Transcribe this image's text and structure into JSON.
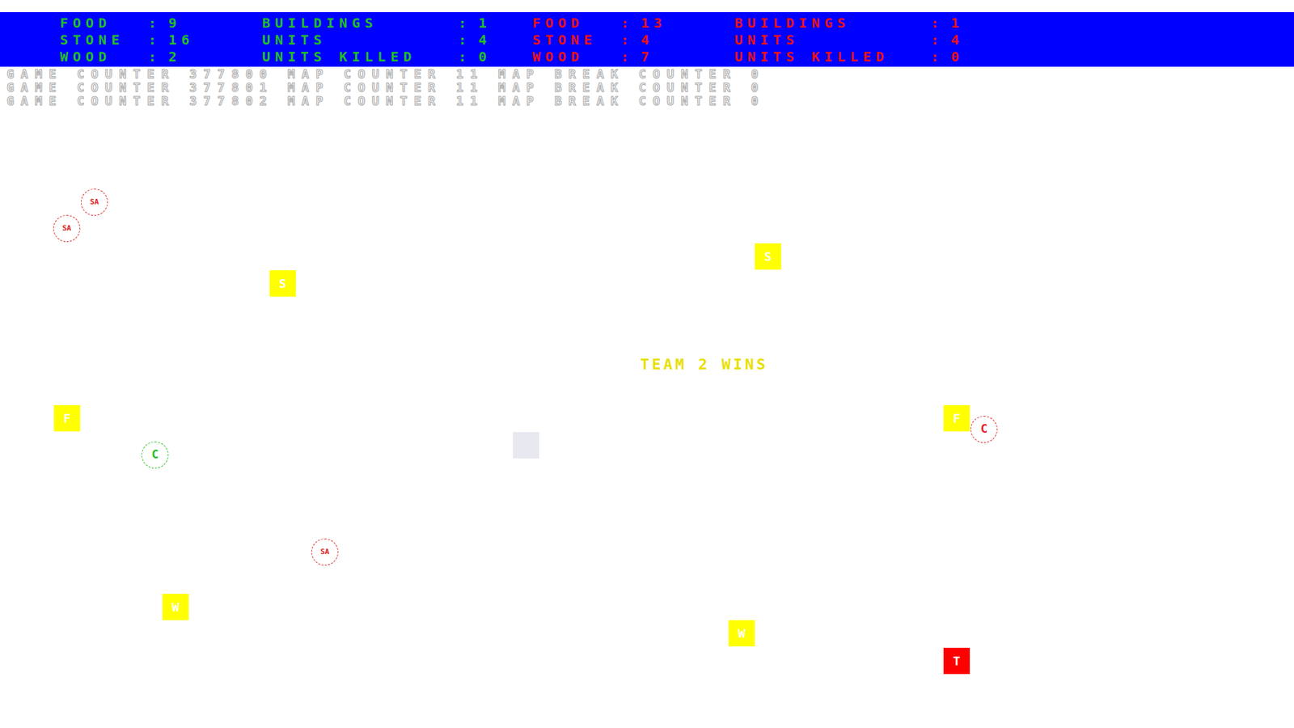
{
  "teams": [
    {
      "name": "team-1",
      "color": "#22c022",
      "resources": [
        {
          "label": "FOOD",
          "value": "9"
        },
        {
          "label": "STONE",
          "value": "16"
        },
        {
          "label": "WOOD",
          "value": "2"
        }
      ],
      "totals": [
        {
          "label": "BUILDINGS",
          "value": "1"
        },
        {
          "label": "UNITS",
          "value": "4"
        },
        {
          "label": "UNITS KILLED",
          "value": "0"
        }
      ]
    },
    {
      "name": "team-2",
      "color": "#ee1111",
      "resources": [
        {
          "label": "FOOD",
          "value": "13"
        },
        {
          "label": "STONE",
          "value": "4"
        },
        {
          "label": "WOOD",
          "value": "7"
        }
      ],
      "totals": [
        {
          "label": "BUILDINGS",
          "value": "1"
        },
        {
          "label": "UNITS",
          "value": "4"
        },
        {
          "label": "UNITS KILLED",
          "value": "0"
        }
      ]
    }
  ],
  "separator": ":",
  "counters": [
    "GAME COUNTER 377800 MAP COUNTER 11 MAP BREAK COUNTER 0",
    "GAME COUNTER 377801 MAP COUNTER 11 MAP BREAK COUNTER 0",
    "GAME COUNTER 377802 MAP COUNTER 11 MAP BREAK COUNTER 0"
  ],
  "message": "TEAM 2 WINS",
  "entities": [
    {
      "kind": "unit",
      "label": "SA",
      "color": "#dd2222"
    },
    {
      "kind": "unit",
      "label": "SA",
      "color": "#dd2222"
    },
    {
      "kind": "unit",
      "label": "SA",
      "color": "#dd2222"
    },
    {
      "kind": "unit",
      "label": "C",
      "color": "#22c022"
    },
    {
      "kind": "unit",
      "label": "C",
      "color": "#dd2222"
    },
    {
      "kind": "resource",
      "label": "S",
      "color": "#ffff00"
    },
    {
      "kind": "resource",
      "label": "S",
      "color": "#ffff00"
    },
    {
      "kind": "resource",
      "label": "F",
      "color": "#ffff00"
    },
    {
      "kind": "resource",
      "label": "F",
      "color": "#ffff00"
    },
    {
      "kind": "resource",
      "label": "W",
      "color": "#ffff00"
    },
    {
      "kind": "resource",
      "label": "W",
      "color": "#ffff00"
    },
    {
      "kind": "building",
      "label": "T",
      "color": "#ff0000"
    },
    {
      "kind": "blank",
      "label": "",
      "color": "#e8e8f0"
    }
  ]
}
